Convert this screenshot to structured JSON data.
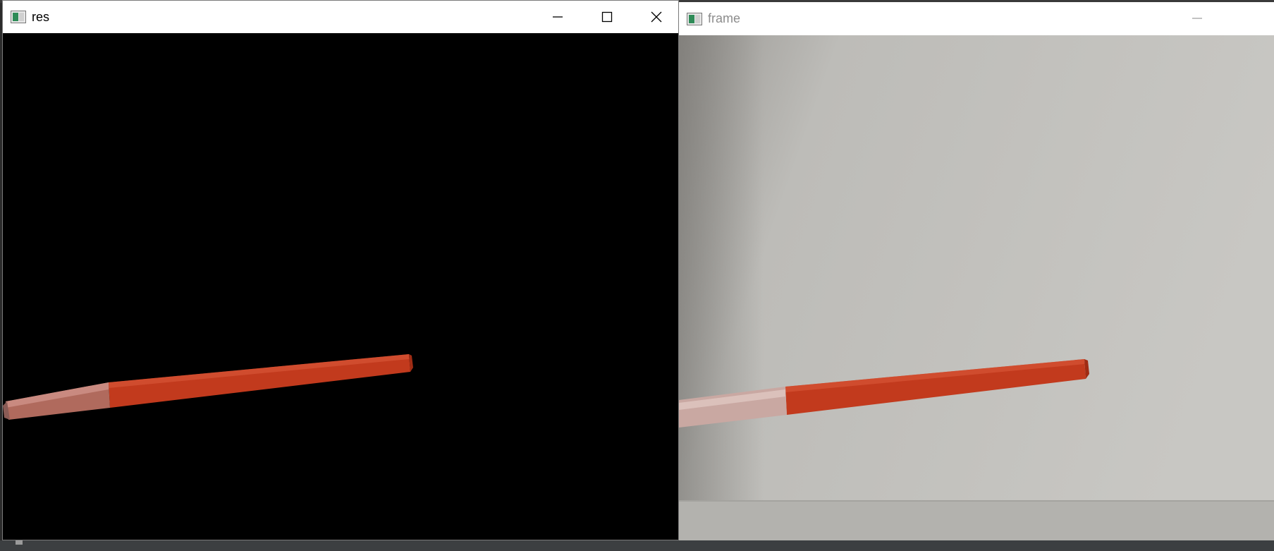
{
  "windows": {
    "res": {
      "title": "res",
      "icon": "opencv-window-icon",
      "buttons": {
        "minimize": "minimize-icon",
        "maximize": "maximize-icon",
        "close": "close-icon"
      }
    },
    "frame": {
      "title": "frame",
      "icon": "opencv-window-icon",
      "buttons": {
        "minimize": "minimize-icon"
      }
    }
  },
  "colors": {
    "mask_background": "#000000",
    "pen_red": "#c23a1d",
    "wall_gray": "#bdbcb8",
    "titlebar": "#ffffff"
  }
}
